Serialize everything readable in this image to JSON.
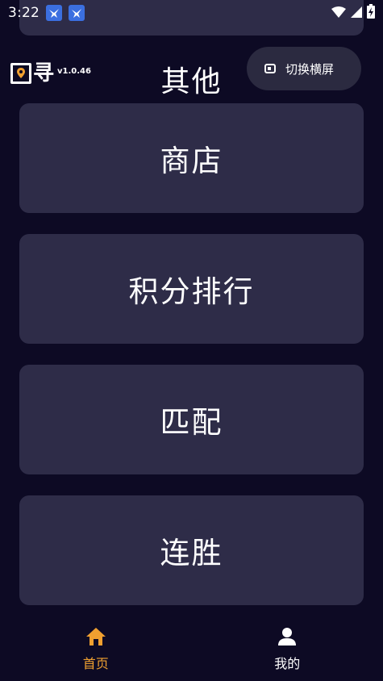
{
  "status_bar": {
    "time": "3:22",
    "notification_icons": [
      "bird-app-icon",
      "bird-app-icon"
    ],
    "system_icons": [
      "wifi-icon",
      "cell-signal-icon",
      "battery-charging-icon"
    ]
  },
  "logo": {
    "char": "寻",
    "version": "v1.0.46"
  },
  "section_title": "其他",
  "toggle_orientation": {
    "label": "切换横屏",
    "icon": "screen-rotate-icon"
  },
  "menu": {
    "items": [
      {
        "label": "商店"
      },
      {
        "label": "积分排行"
      },
      {
        "label": "匹配"
      },
      {
        "label": "连胜"
      }
    ]
  },
  "bottom_nav": {
    "items": [
      {
        "label": "首页",
        "icon": "home-icon",
        "active": true
      },
      {
        "label": "我的",
        "icon": "person-icon",
        "active": false
      }
    ]
  },
  "colors": {
    "background": "#0d0a24",
    "card": "#2e2c48",
    "accent": "#f0a030",
    "logo_pin": "#f0a030"
  }
}
